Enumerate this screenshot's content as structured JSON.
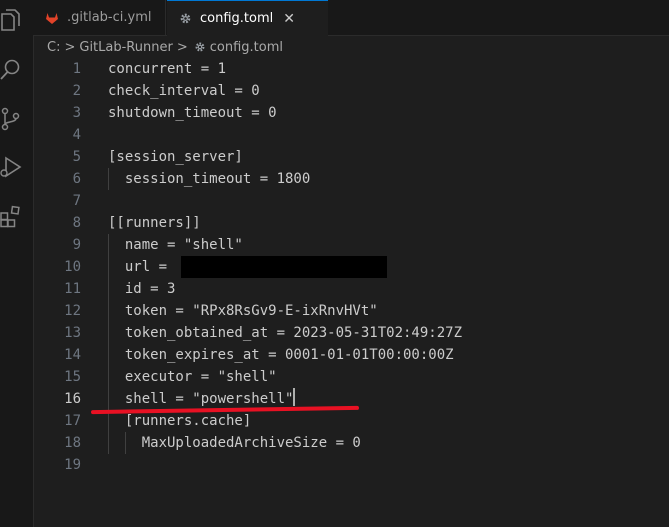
{
  "tabs": [
    {
      "label": ".gitlab-ci.yml",
      "icon": "gitlab-icon",
      "active": false
    },
    {
      "label": "config.toml",
      "icon": "gear-icon",
      "active": true,
      "close": "✕"
    }
  ],
  "breadcrumb": {
    "parts": [
      "C:",
      "GitLab-Runner",
      "config.toml"
    ],
    "separator": ">"
  },
  "editor": {
    "current_line": 16,
    "lines": [
      {
        "n": "1",
        "text": "concurrent = 1"
      },
      {
        "n": "2",
        "text": "check_interval = 0"
      },
      {
        "n": "3",
        "text": "shutdown_timeout = 0"
      },
      {
        "n": "4",
        "text": ""
      },
      {
        "n": "5",
        "text": "[session_server]"
      },
      {
        "n": "6",
        "text": "  session_timeout = 1800"
      },
      {
        "n": "7",
        "text": ""
      },
      {
        "n": "8",
        "text": "[[runners]]"
      },
      {
        "n": "9",
        "text": "  name = \"shell\""
      },
      {
        "n": "10",
        "text": "  url = "
      },
      {
        "n": "11",
        "text": "  id = 3"
      },
      {
        "n": "12",
        "text": "  token = \"RPx8RsGv9-E-ixRnvHVt\""
      },
      {
        "n": "13",
        "text": "  token_obtained_at = 2023-05-31T02:49:27Z"
      },
      {
        "n": "14",
        "text": "  token_expires_at = 0001-01-01T00:00:00Z"
      },
      {
        "n": "15",
        "text": "  executor = \"shell\""
      },
      {
        "n": "16",
        "text": "  shell = \"powershell\""
      },
      {
        "n": "17",
        "text": "  [runners.cache]"
      },
      {
        "n": "18",
        "text": "    MaxUploadedArchiveSize = 0"
      },
      {
        "n": "19",
        "text": ""
      }
    ]
  },
  "colors": {
    "accent": "#0078d4",
    "annotation": "#e81123",
    "gitlab": "#e24329"
  }
}
